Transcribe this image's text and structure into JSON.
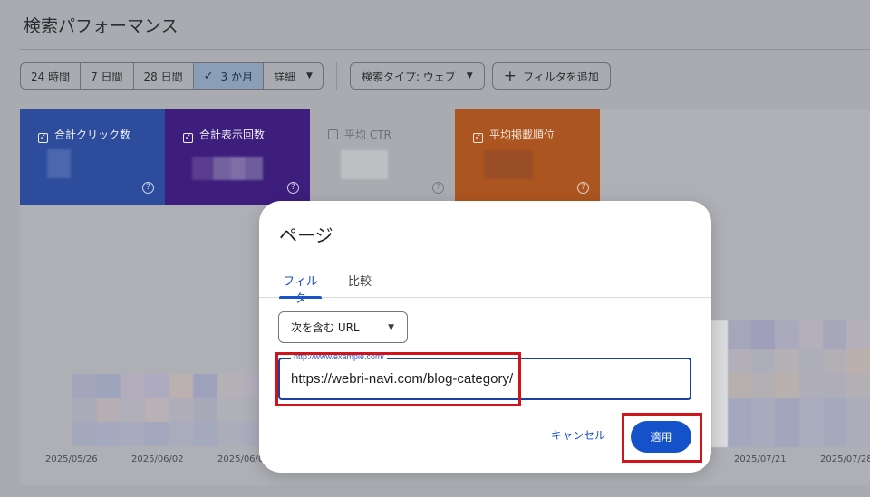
{
  "header": {
    "title": "検索パフォーマンス"
  },
  "toolbar": {
    "ranges": [
      {
        "label": "24 時間",
        "active": false
      },
      {
        "label": "7 日間",
        "active": false
      },
      {
        "label": "28 日間",
        "active": false
      },
      {
        "label": "3 か月",
        "active": true
      },
      {
        "label": "詳細",
        "active": false
      }
    ],
    "search_type_label": "検索タイプ: ウェブ",
    "add_filter_label": "フィルタを追加"
  },
  "metrics": [
    {
      "label": "合計クリック数",
      "checked": true,
      "color": "#2d4c9c"
    },
    {
      "label": "合計表示回数",
      "checked": true,
      "color": "#3e1e7d"
    },
    {
      "label": "平均 CTR",
      "checked": false,
      "color": "#a9abb0"
    },
    {
      "label": "平均掲載順位",
      "checked": true,
      "color": "#ad5520"
    }
  ],
  "chart": {
    "x_labels": [
      "2025/05/26",
      "2025/06/02",
      "2025/06/0",
      "2025/07/21",
      "2025/07/28"
    ]
  },
  "dialog": {
    "title": "ページ",
    "tabs": [
      {
        "label": "フィルタ",
        "active": true
      },
      {
        "label": "比較",
        "active": false
      }
    ],
    "match_type": "次を含む URL",
    "url_placeholder_label": "http://www.example.com/",
    "url_value": "https://webri-navi.com/blog-category/",
    "cancel_label": "キャンセル",
    "apply_label": "適用"
  },
  "colors": {
    "accent": "#1a53c7",
    "apply_button": "#1551c9",
    "highlight_box": "#d0141b"
  }
}
